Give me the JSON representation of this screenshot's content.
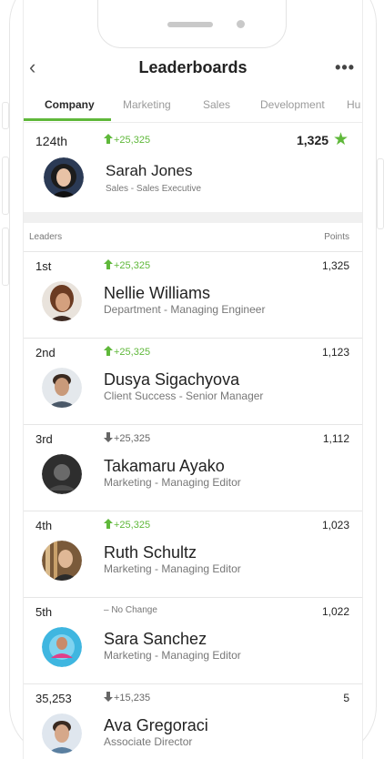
{
  "header": {
    "title": "Leaderboards"
  },
  "tabs": [
    {
      "label": "Company",
      "active": true
    },
    {
      "label": "Marketing"
    },
    {
      "label": "Sales"
    },
    {
      "label": "Development"
    },
    {
      "label": "Hu"
    }
  ],
  "my_rank": {
    "rank": "124th",
    "change": "+25,325",
    "points": "1,325",
    "name": "Sarah Jones",
    "role": "Sales - Sales Executive"
  },
  "columns": {
    "leaders": "Leaders",
    "points": "Points"
  },
  "leaders": [
    {
      "rank": "1st",
      "change": "+25,325",
      "direction": "up",
      "points": "1,325",
      "name": "Nellie Williams",
      "role": "Department - Managing Engineer"
    },
    {
      "rank": "2nd",
      "change": "+25,325",
      "direction": "up",
      "points": "1,123",
      "name": "Dusya Sigachyova",
      "role": "Client Success - Senior Manager"
    },
    {
      "rank": "3rd",
      "change": "+25,325",
      "direction": "down",
      "points": "1,112",
      "name": "Takamaru Ayako",
      "role": "Marketing - Managing Editor"
    },
    {
      "rank": "4th",
      "change": "+25,325",
      "direction": "up",
      "points": "1,023",
      "name": "Ruth Schultz",
      "role": "Marketing - Managing Editor"
    },
    {
      "rank": "5th",
      "change": "– No Change",
      "direction": "none",
      "points": "1,022",
      "name": "Sara Sanchez",
      "role": "Marketing - Managing Editor"
    },
    {
      "rank": "35,253",
      "change": "+15,235",
      "direction": "down",
      "points": "5",
      "name": "Ava Gregoraci",
      "role": "Associate Director"
    }
  ],
  "colors": {
    "accent": "#5fb83a"
  }
}
